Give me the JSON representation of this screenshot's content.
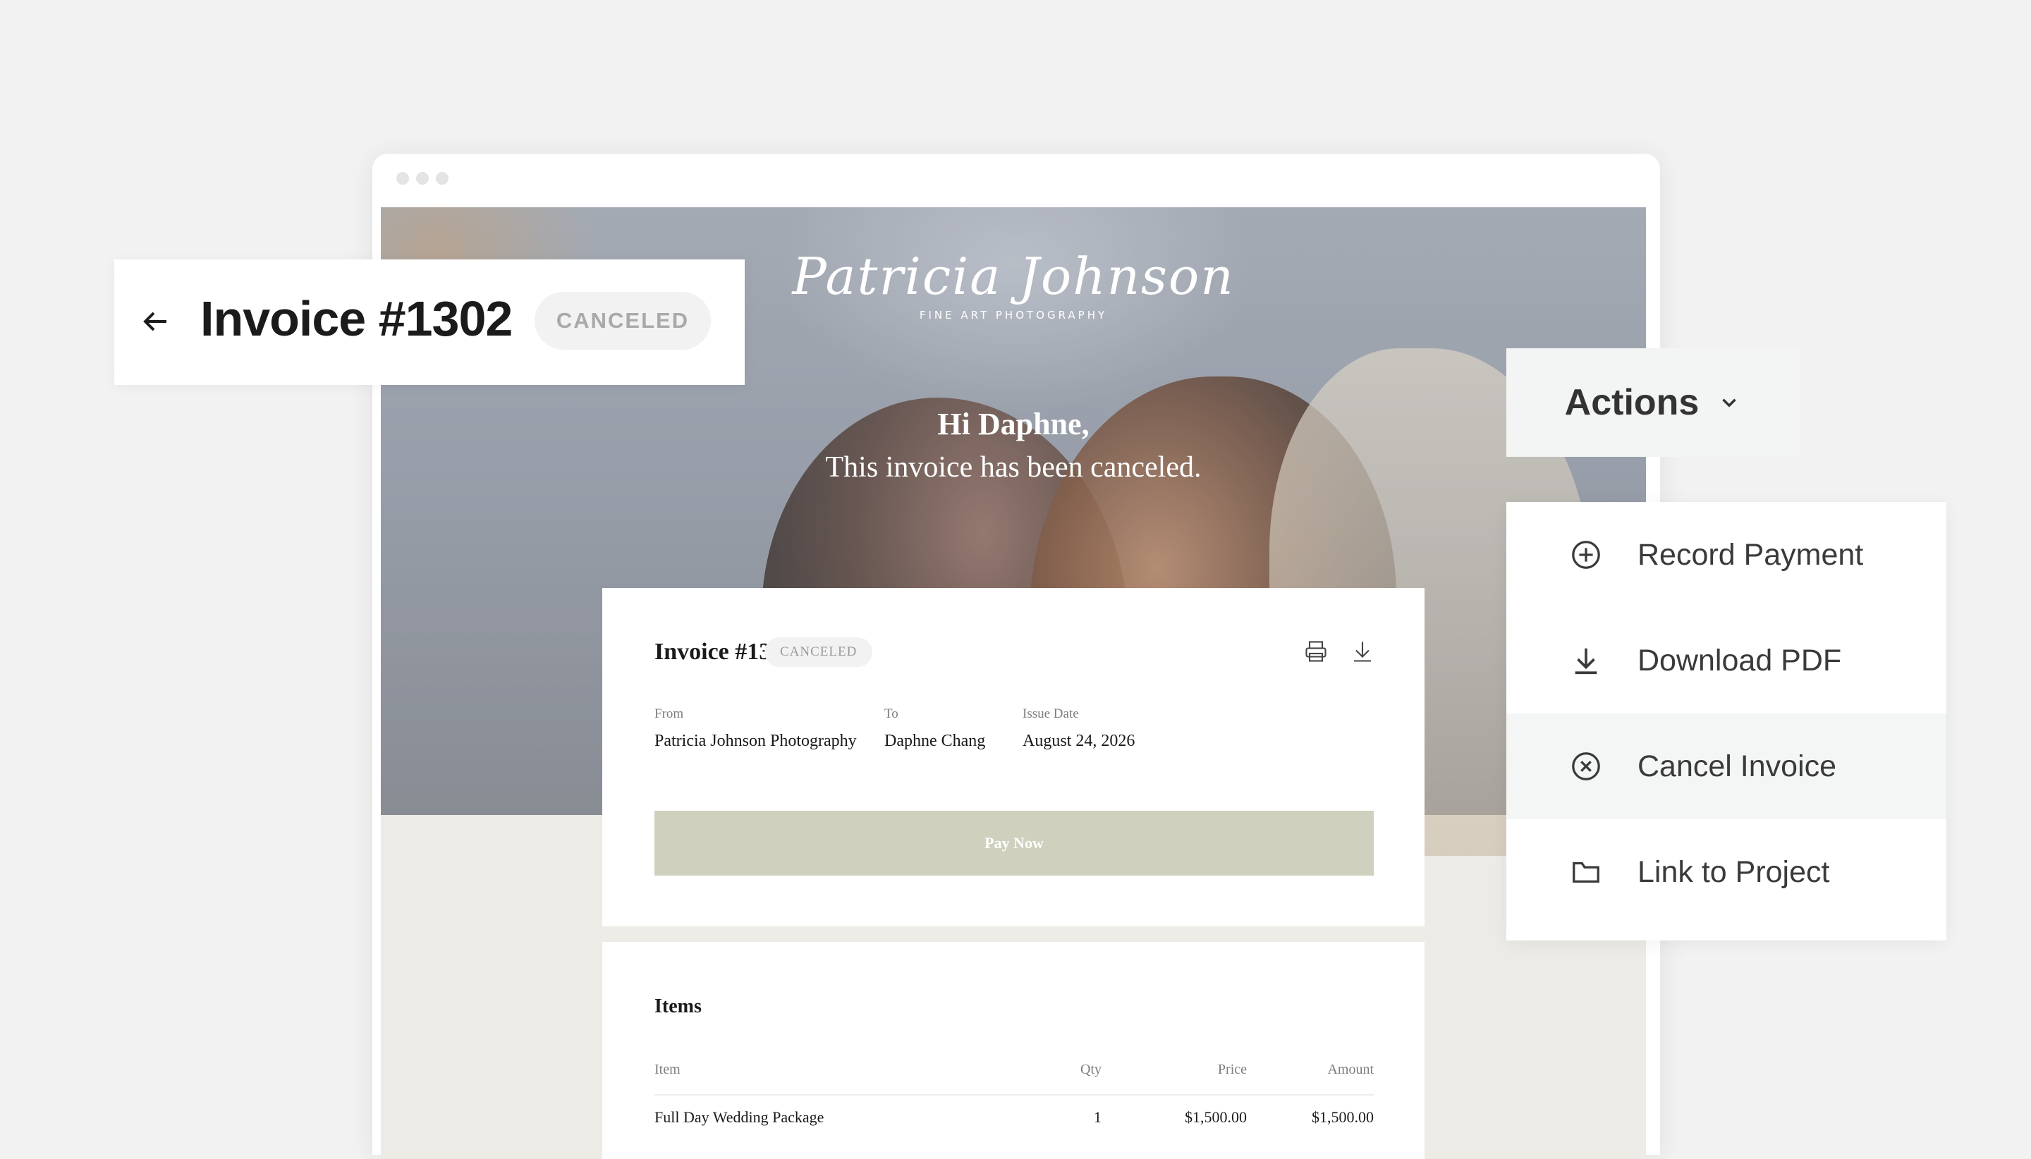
{
  "header": {
    "title": "Invoice #1302",
    "status": "CANCELED"
  },
  "actions": {
    "label": "Actions",
    "menu": [
      {
        "label": "Record Payment",
        "icon": "plus-circle-icon"
      },
      {
        "label": "Download PDF",
        "icon": "download-icon"
      },
      {
        "label": "Cancel Invoice",
        "icon": "x-circle-icon"
      },
      {
        "label": "Link to Project",
        "icon": "folder-icon"
      }
    ]
  },
  "preview": {
    "logo_script": "Patricia Johnson",
    "logo_sub": "FINE ART        PHOTOGRAPHY",
    "greeting": "Hi Daphne,",
    "message": "This invoice has been canceled.",
    "invoice": {
      "title": "Invoice #1302",
      "status": "CANCELED",
      "from_label": "From",
      "from_value": "Patricia Johnson Photography",
      "to_label": "To",
      "to_value": "Daphne Chang",
      "date_label": "Issue Date",
      "date_value": "August 24, 2026",
      "pay_button": "Pay Now"
    },
    "items": {
      "title": "Items",
      "columns": [
        "Item",
        "Qty",
        "Price",
        "Amount"
      ],
      "rows": [
        {
          "item": "Full Day Wedding Package",
          "qty": "1",
          "price": "$1,500.00",
          "amount": "$1,500.00"
        }
      ]
    }
  },
  "colors": {
    "page_bg": "#f2f2f2",
    "pay_button": "#cfd0bd",
    "badge_bg": "#f2f2f2",
    "badge_text": "#a9a9a9",
    "menu_active": "#f4f5f5"
  }
}
